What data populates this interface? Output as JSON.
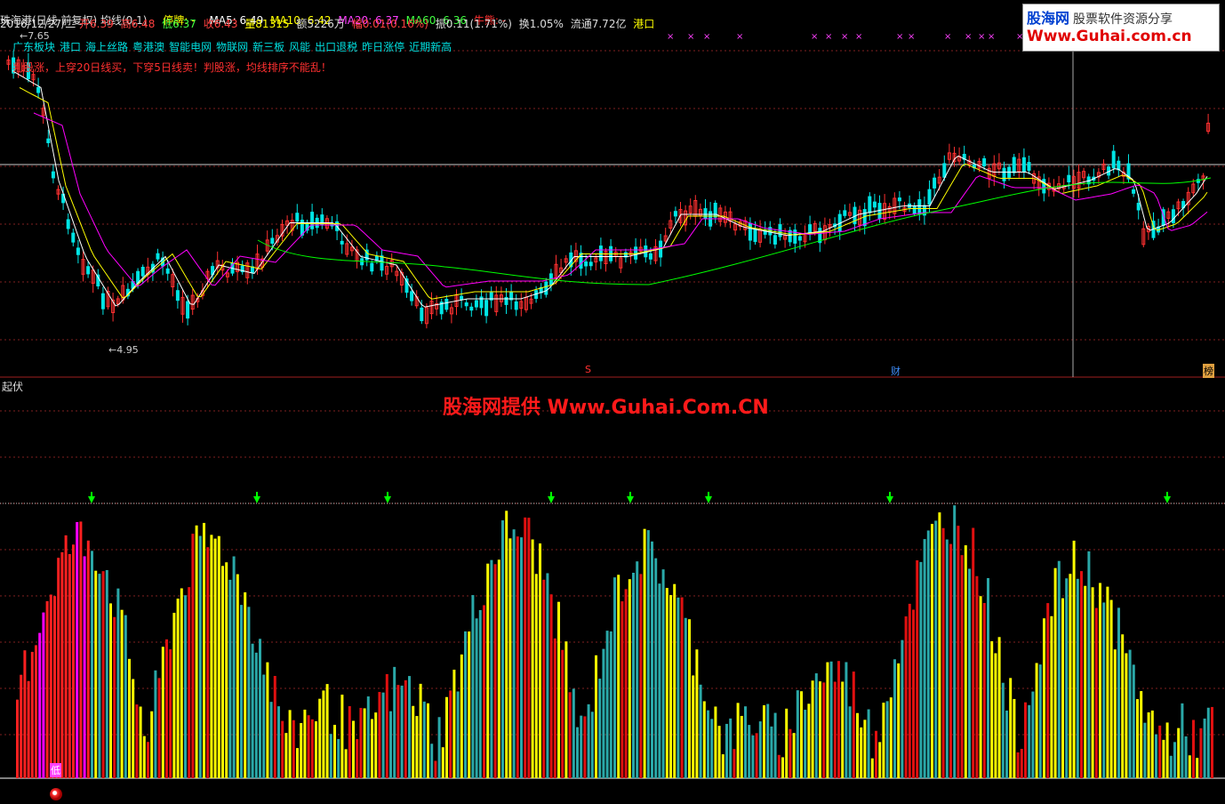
{
  "stock": {
    "title": "珠海港(日线 前复权) 均线(0,1)",
    "limit_label": "停牌:",
    "limit_value": "-",
    "ma5_label": "MA5: 6.49",
    "ma10_label": "MA10: 6.42",
    "ma20_label": "MA20: 6.37",
    "ma60_label": "MA60: 6.36",
    "bull_label": "牛熊: -"
  },
  "quote": {
    "date": "2016/12/27/二",
    "open": "开6.39",
    "high": "高6.48",
    "low": "低6.37",
    "close": "收6.43",
    "volume": "量81315",
    "amount": "额5226万",
    "change": "幅0.01(0.16%)",
    "amplitude": "振0.11(1.71%)",
    "turnover": "换1.05%",
    "float_cap": "流通7.72亿",
    "sector": "港口"
  },
  "concepts": [
    "广东板块",
    "港口",
    "海上丝路",
    "粤港澳",
    "智能电网",
    "物联网",
    "新三板",
    "风能",
    "出口退税",
    "昨日涨停",
    "近期新高"
  ],
  "signal_note": "判股涨，上穿20日线买，下穿5日线卖！判股涨，均线排序不能乱！",
  "price_high_label": "7.65",
  "price_low_label": "4.95",
  "events": {
    "s": "S",
    "finance": "财",
    "rank": "榜"
  },
  "indicator": {
    "title": "起伏",
    "start_label": "低"
  },
  "watermark": "股海网提供 Www.Guhai.Com.CN",
  "logo": {
    "name": "股海网",
    "slogan": "股票软件资源分享",
    "url": "Www.Guhai.com.cn"
  },
  "colors": {
    "up": "#ff3030",
    "down": "#00e5e5",
    "ma5": "#ffffff",
    "ma10": "#ffff00",
    "ma20": "#ff00ff",
    "ma60": "#00ff00"
  }
}
